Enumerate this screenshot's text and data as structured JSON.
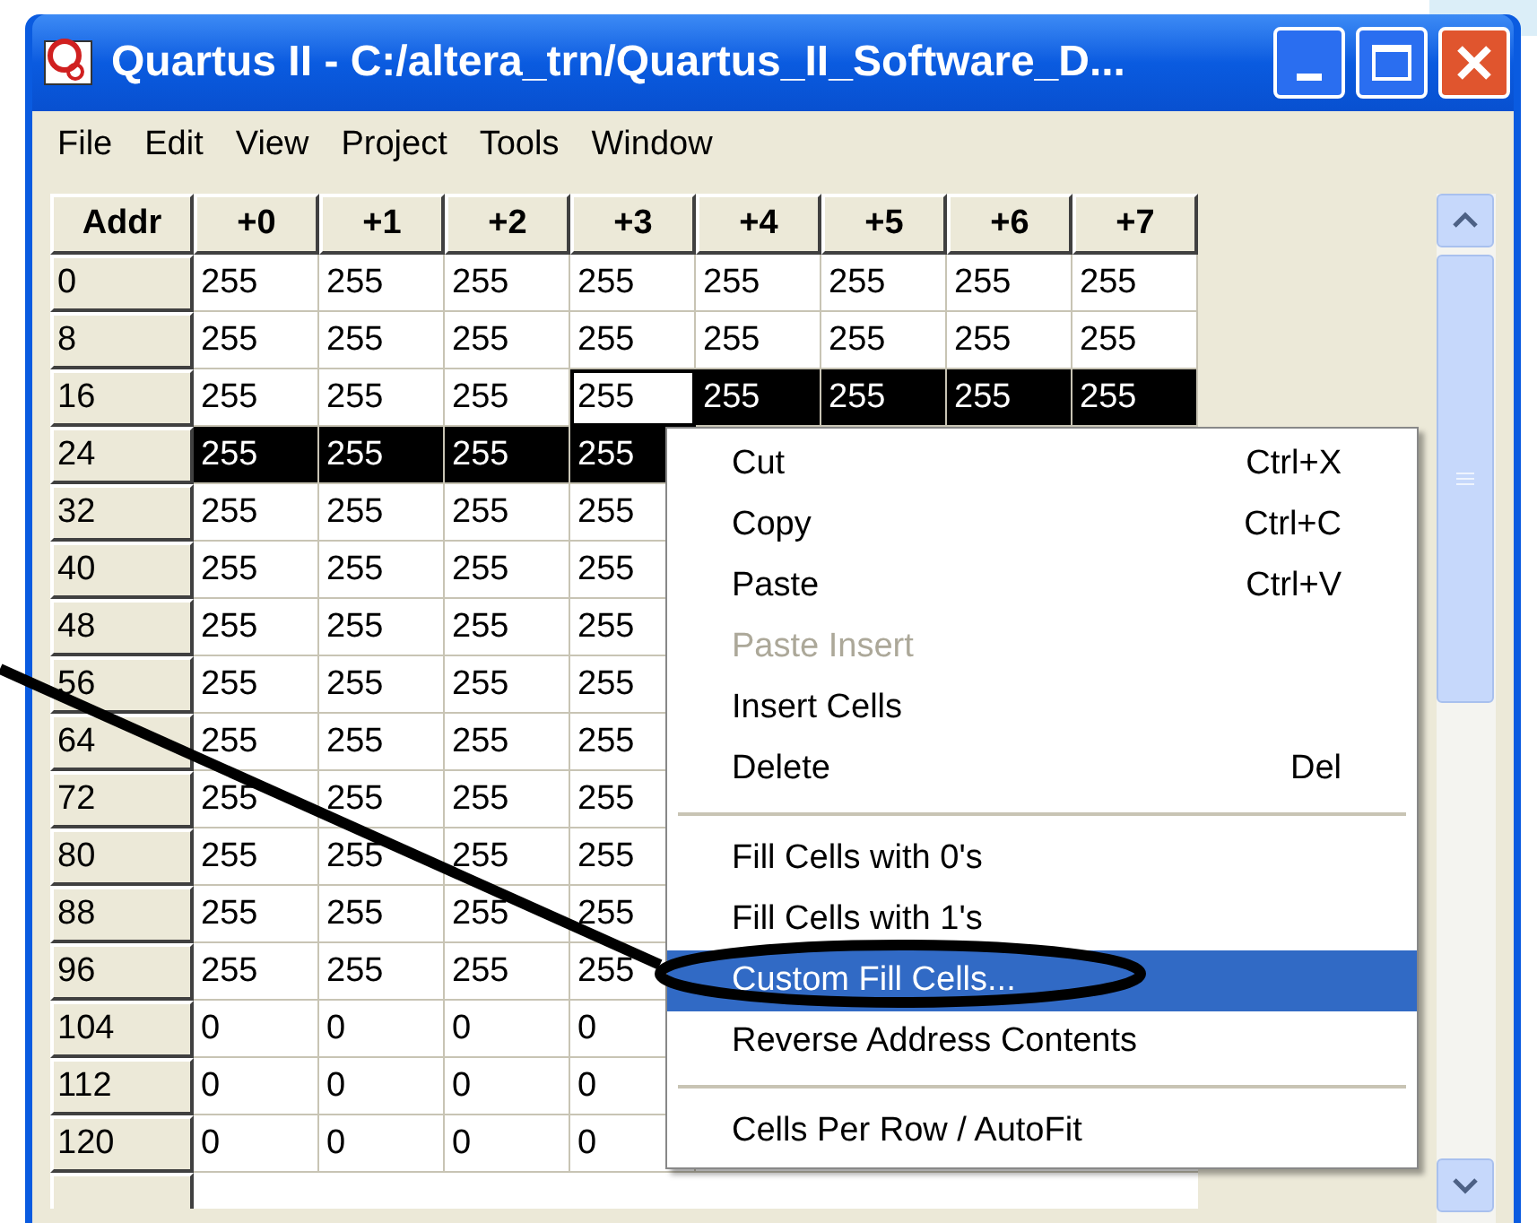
{
  "window": {
    "title": "Quartus II - C:/altera_trn/Quartus_II_Software_D..."
  },
  "menu_bar": [
    "File",
    "Edit",
    "View",
    "Project",
    "Tools",
    "Window"
  ],
  "table": {
    "columns": [
      "Addr",
      "+0",
      "+1",
      "+2",
      "+3",
      "+4",
      "+5",
      "+6",
      "+7"
    ],
    "rows": [
      {
        "addr": "0",
        "cells": [
          {
            "value": "255",
            "selected": false
          },
          {
            "value": "255",
            "selected": false
          },
          {
            "value": "255",
            "selected": false
          },
          {
            "value": "255",
            "selected": false
          },
          {
            "value": "255",
            "selected": false
          },
          {
            "value": "255",
            "selected": false
          },
          {
            "value": "255",
            "selected": false
          },
          {
            "value": "255",
            "selected": false
          }
        ]
      },
      {
        "addr": "8",
        "cells": [
          {
            "value": "255",
            "selected": false
          },
          {
            "value": "255",
            "selected": false
          },
          {
            "value": "255",
            "selected": false
          },
          {
            "value": "255",
            "selected": false
          },
          {
            "value": "255",
            "selected": false
          },
          {
            "value": "255",
            "selected": false
          },
          {
            "value": "255",
            "selected": false
          },
          {
            "value": "255",
            "selected": false
          }
        ]
      },
      {
        "addr": "16",
        "cells": [
          {
            "value": "255",
            "selected": false
          },
          {
            "value": "255",
            "selected": false
          },
          {
            "value": "255",
            "selected": false
          },
          {
            "value": "255",
            "selected": false,
            "focused": true
          },
          {
            "value": "255",
            "selected": true
          },
          {
            "value": "255",
            "selected": true
          },
          {
            "value": "255",
            "selected": true
          },
          {
            "value": "255",
            "selected": true
          }
        ]
      },
      {
        "addr": "24",
        "cells": [
          {
            "value": "255",
            "selected": true
          },
          {
            "value": "255",
            "selected": true
          },
          {
            "value": "255",
            "selected": true
          },
          {
            "value": "255",
            "selected": true
          }
        ]
      },
      {
        "addr": "32",
        "cells": [
          {
            "value": "255",
            "selected": false
          },
          {
            "value": "255",
            "selected": false
          },
          {
            "value": "255",
            "selected": false
          },
          {
            "value": "255",
            "selected": false
          }
        ]
      },
      {
        "addr": "40",
        "cells": [
          {
            "value": "255",
            "selected": false
          },
          {
            "value": "255",
            "selected": false
          },
          {
            "value": "255",
            "selected": false
          },
          {
            "value": "255",
            "selected": false
          }
        ]
      },
      {
        "addr": "48",
        "cells": [
          {
            "value": "255",
            "selected": false
          },
          {
            "value": "255",
            "selected": false
          },
          {
            "value": "255",
            "selected": false
          },
          {
            "value": "255",
            "selected": false
          }
        ]
      },
      {
        "addr": "56",
        "cells": [
          {
            "value": "255",
            "selected": false
          },
          {
            "value": "255",
            "selected": false
          },
          {
            "value": "255",
            "selected": false
          },
          {
            "value": "255",
            "selected": false
          }
        ]
      },
      {
        "addr": "64",
        "cells": [
          {
            "value": "255",
            "selected": false
          },
          {
            "value": "255",
            "selected": false
          },
          {
            "value": "255",
            "selected": false
          },
          {
            "value": "255",
            "selected": false
          }
        ]
      },
      {
        "addr": "72",
        "cells": [
          {
            "value": "255",
            "selected": false
          },
          {
            "value": "255",
            "selected": false
          },
          {
            "value": "255",
            "selected": false
          },
          {
            "value": "255",
            "selected": false
          }
        ]
      },
      {
        "addr": "80",
        "cells": [
          {
            "value": "255",
            "selected": false
          },
          {
            "value": "255",
            "selected": false
          },
          {
            "value": "255",
            "selected": false
          },
          {
            "value": "255",
            "selected": false
          }
        ]
      },
      {
        "addr": "88",
        "cells": [
          {
            "value": "255",
            "selected": false
          },
          {
            "value": "255",
            "selected": false
          },
          {
            "value": "255",
            "selected": false
          },
          {
            "value": "255",
            "selected": false
          }
        ]
      },
      {
        "addr": "96",
        "cells": [
          {
            "value": "255",
            "selected": false
          },
          {
            "value": "255",
            "selected": false
          },
          {
            "value": "255",
            "selected": false
          },
          {
            "value": "255",
            "selected": false
          }
        ]
      },
      {
        "addr": "104",
        "cells": [
          {
            "value": "0",
            "selected": false
          },
          {
            "value": "0",
            "selected": false
          },
          {
            "value": "0",
            "selected": false
          },
          {
            "value": "0",
            "selected": false
          }
        ]
      },
      {
        "addr": "112",
        "cells": [
          {
            "value": "0",
            "selected": false
          },
          {
            "value": "0",
            "selected": false
          },
          {
            "value": "0",
            "selected": false
          },
          {
            "value": "0",
            "selected": false
          }
        ]
      },
      {
        "addr": "120",
        "cells": [
          {
            "value": "0",
            "selected": false
          },
          {
            "value": "0",
            "selected": false
          },
          {
            "value": "0",
            "selected": false
          },
          {
            "value": "0",
            "selected": false
          }
        ]
      }
    ]
  },
  "context_menu": [
    {
      "kind": "item",
      "label": "Cut",
      "shortcut": "Ctrl+X",
      "disabled": false,
      "selected": false
    },
    {
      "kind": "item",
      "label": "Copy",
      "shortcut": "Ctrl+C",
      "disabled": false,
      "selected": false
    },
    {
      "kind": "item",
      "label": "Paste",
      "shortcut": "Ctrl+V",
      "disabled": false,
      "selected": false
    },
    {
      "kind": "item",
      "label": "Paste Insert",
      "disabled": true,
      "selected": false
    },
    {
      "kind": "item",
      "label": "Insert Cells",
      "disabled": false,
      "selected": false
    },
    {
      "kind": "item",
      "label": "Delete",
      "shortcut": "Del",
      "disabled": false,
      "selected": false
    },
    {
      "kind": "separator"
    },
    {
      "kind": "item",
      "label": "Fill Cells with 0's",
      "disabled": false,
      "selected": false
    },
    {
      "kind": "item",
      "label": "Fill Cells with 1's",
      "disabled": false,
      "selected": false
    },
    {
      "kind": "item",
      "label": "Custom Fill Cells...",
      "disabled": false,
      "selected": true
    },
    {
      "kind": "item",
      "label": "Reverse Address Contents",
      "disabled": false,
      "selected": false
    },
    {
      "kind": "separator"
    },
    {
      "kind": "item",
      "label": "Cells Per Row / AutoFit",
      "disabled": false,
      "selected": false
    }
  ]
}
